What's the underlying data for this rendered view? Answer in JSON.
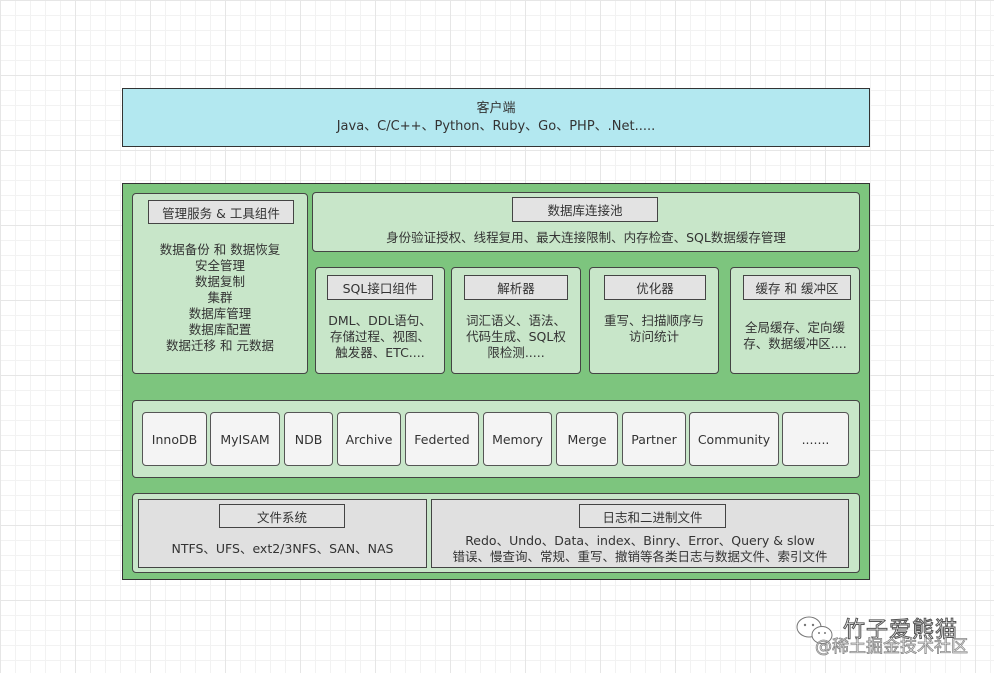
{
  "client": {
    "title": "客户端",
    "languages": "Java、C/C++、Python、Ruby、Go、PHP、.Net....."
  },
  "management": {
    "title": "管理服务 & 工具组件",
    "items": [
      "数据备份 和 数据恢复",
      "安全管理",
      "数据复制",
      "集群",
      "数据库管理",
      "数据库配置",
      "数据迁移 和 元数据"
    ]
  },
  "connection_pool": {
    "title": "数据库连接池",
    "description": "身份验证授权、线程复用、最大连接限制、内存检查、SQL数据缓存管理"
  },
  "sql_interface": {
    "title": "SQL接口组件",
    "lines": [
      "DML、DDL语句、",
      "存储过程、视图、",
      "触发器、ETC...."
    ]
  },
  "parser": {
    "title": "解析器",
    "lines": [
      "词汇语义、语法、",
      "代码生成、SQL权",
      "限检测....."
    ]
  },
  "optimizer": {
    "title": "优化器",
    "lines": [
      "重写、扫描顺序与",
      "访问统计"
    ]
  },
  "cache": {
    "title": "缓存 和 缓冲区",
    "lines": [
      "全局缓存、定向缓",
      "存、数据缓冲区...."
    ]
  },
  "engines": [
    "InnoDB",
    "MyISAM",
    "NDB",
    "Archive",
    "Federted",
    "Memory",
    "Merge",
    "Partner",
    "Community",
    "......."
  ],
  "file_system": {
    "title": "文件系统",
    "description": "NTFS、UFS、ext2/3NFS、SAN、NAS"
  },
  "logs": {
    "title": "日志和二进制文件",
    "line1": "Redo、Undo、Data、index、Binry、Error、Query & slow",
    "line2": "错误、慢查询、常规、重写、撤销等各类日志与数据文件、索引文件"
  },
  "watermark": {
    "icon": "wechat-icon",
    "name": "竹子爱熊猫",
    "sub": "@稀土掘金技术社区"
  }
}
